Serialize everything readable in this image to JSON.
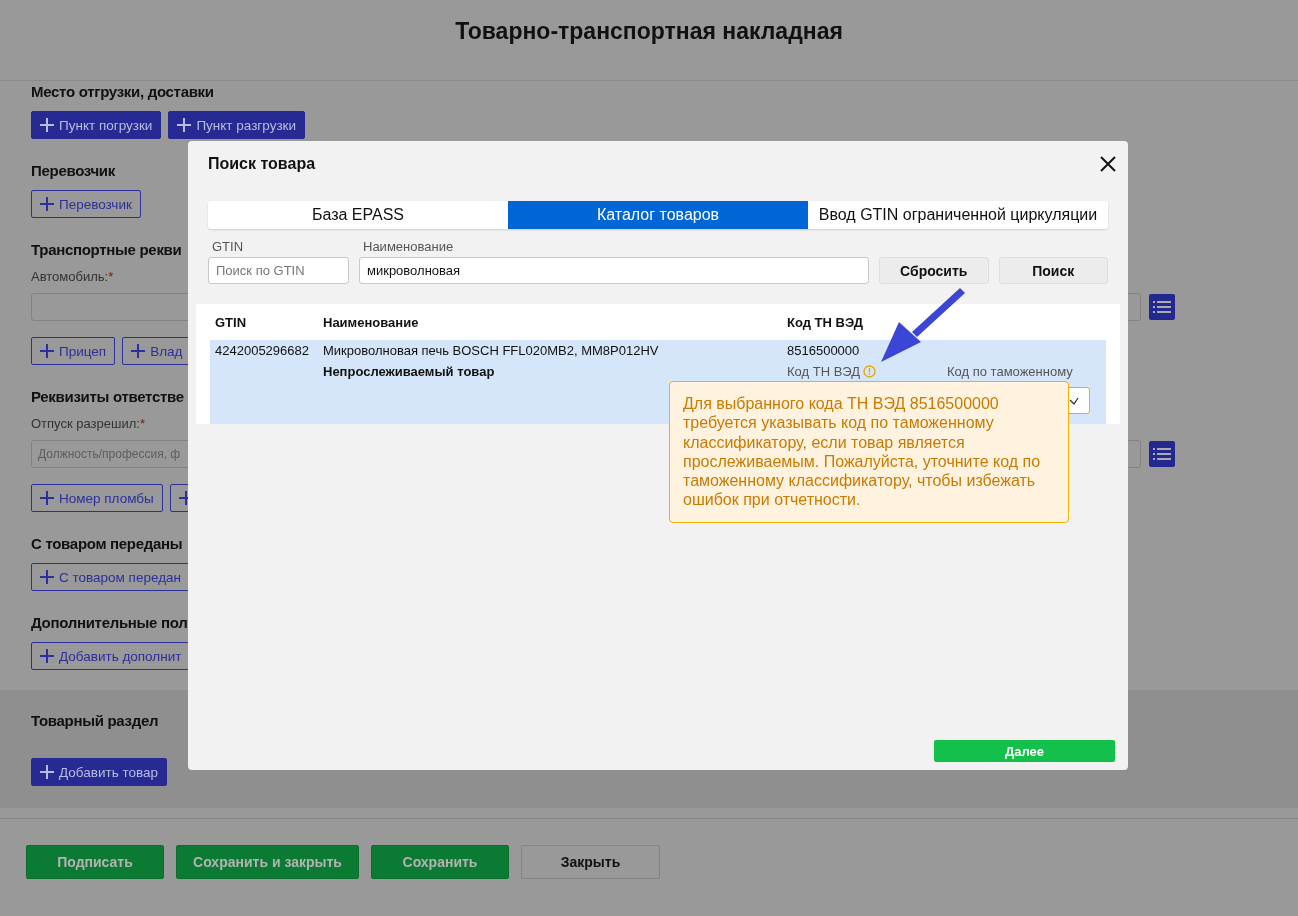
{
  "page": {
    "title": "Товарно-транспортная накладная"
  },
  "sections": [
    {
      "heading": "Место отгрузки, доставки",
      "buttons": [
        {
          "label": "Пункт погрузки",
          "kind": "filled"
        },
        {
          "label": "Пункт разгрузки",
          "kind": "filled"
        }
      ]
    },
    {
      "heading": "Перевозчик",
      "buttons": [
        {
          "label": "Перевозчик",
          "kind": "outline"
        }
      ]
    },
    {
      "heading": "Транспортные рекви",
      "field": {
        "label": "Автомобиль:",
        "required_mark": "*"
      },
      "buttons": [
        {
          "label": "Прицеп",
          "kind": "outline"
        },
        {
          "label": "Влад",
          "kind": "outline"
        }
      ]
    },
    {
      "heading": "Реквизиты ответстве",
      "field": {
        "label": "Отпуск разрешил:",
        "required_mark": "*",
        "placeholder": "Должность/профессия, ф"
      },
      "buttons": [
        {
          "label": "Номер пломбы",
          "kind": "outline"
        },
        {
          "kind": "outline"
        }
      ]
    },
    {
      "heading": "С товаром переданы",
      "buttons": [
        {
          "label": "С товаром передан",
          "kind": "outline"
        }
      ]
    },
    {
      "heading": "Дополнительные пол",
      "buttons": [
        {
          "label": "Добавить дополнит",
          "kind": "outline"
        }
      ]
    }
  ],
  "product_section": {
    "heading": "Товарный раздел",
    "buttons": [
      {
        "label": "Добавить товар",
        "kind": "filled"
      }
    ]
  },
  "footer_buttons": [
    {
      "label": "Подписать",
      "kind": "primary"
    },
    {
      "label": "Сохранить и закрыть",
      "kind": "primary"
    },
    {
      "label": "Сохранить",
      "kind": "primary"
    },
    {
      "label": "Закрыть",
      "kind": "secondary"
    }
  ],
  "modal": {
    "title": "Поиск товара",
    "tabs": [
      {
        "label": "База EPASS",
        "selected": false
      },
      {
        "label": "Каталог товаров",
        "selected": true
      },
      {
        "label": "Ввод GTIN ограниченной циркуляции",
        "selected": false
      }
    ],
    "filters": [
      {
        "label": "GTIN",
        "placeholder": "Поиск по GTIN"
      },
      {
        "label": "Наименование",
        "value": "микроволновая"
      }
    ],
    "actions": [
      "Сбросить",
      "Поиск"
    ],
    "columns": [
      "GTIN",
      "Наименование",
      "Код ТН ВЭД"
    ],
    "rows": [
      {
        "gtin": "4242005296682",
        "name": "Микроволновая печь BOSCH FFL020MB2, MM8P012HV",
        "status": "Непрослеживаемый товар",
        "code": "8516500000",
        "code_label": "Код ТН ВЭД",
        "warning": true,
        "customs_label": "Код по таможенному",
        "selected": true
      }
    ],
    "tooltip": "Для выбранного кода ТН ВЭД 8516500000 требуется указывать код по таможенному классификатору, если товар является прослеживаемым. Пожалуйста, уточните код по таможенному классификатору, чтобы избежать ошибок при отчетности.",
    "next_button": "Далее"
  }
}
